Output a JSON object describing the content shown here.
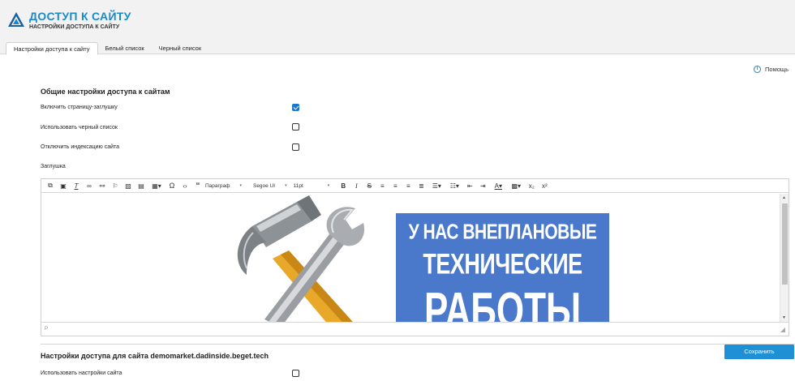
{
  "header": {
    "title": "ДОСТУП К САЙТУ",
    "subtitle": "НАСТРОЙКИ ДОСТУПА К САЙТУ"
  },
  "tabs": [
    {
      "label": "Настройки доступа к сайту",
      "active": true
    },
    {
      "label": "Белый список",
      "active": false
    },
    {
      "label": "Черный список",
      "active": false
    }
  ],
  "help_label": "Помощь",
  "general": {
    "title": "Общие настройки доступа к сайтам",
    "rows": [
      {
        "label": "Включить страницу-заглушку",
        "checked": true
      },
      {
        "label": "Использовать черный список",
        "checked": false
      },
      {
        "label": "Отключить индексацию сайта",
        "checked": false
      }
    ],
    "stub_label": "Заглушка"
  },
  "editor": {
    "paragraph_select": "Параграф",
    "font_select": "Segoe UI",
    "size_select": "11pt",
    "status_path": "P",
    "banner_lines": [
      "У НАС ВНЕПЛАНОВЫЕ",
      "ТЕХНИЧЕСКИЕ",
      "РАБОТЫ"
    ],
    "banner_color": "#4a79cc"
  },
  "site_section": {
    "title": "Настройки доступа для сайта demomarket.dadinside.beget.tech",
    "use_settings_label": "Использовать настройки сайта",
    "use_settings_checked": false
  },
  "save_label": "Сохранить",
  "colors": {
    "accent": "#1a8ac7",
    "save_button": "#1f8fd6",
    "checkbox_checked": "#1976d2"
  }
}
